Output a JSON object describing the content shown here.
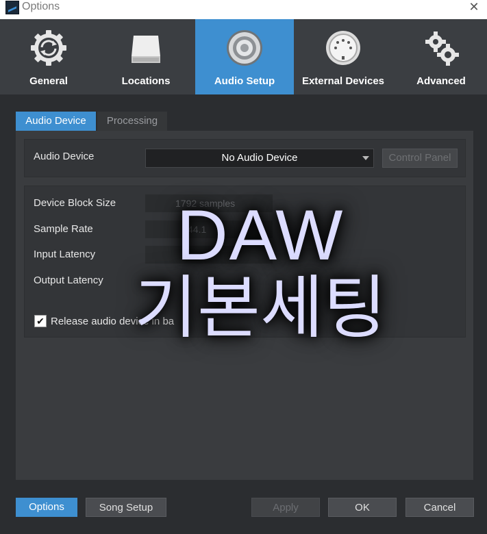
{
  "window": {
    "title": "Options",
    "close_glyph": "✕"
  },
  "main_tabs": [
    {
      "label": "General",
      "icon": "sync-gear-icon"
    },
    {
      "label": "Locations",
      "icon": "drive-icon"
    },
    {
      "label": "Audio Setup",
      "icon": "speaker-icon",
      "active": true
    },
    {
      "label": "External Devices",
      "icon": "midi-port-icon"
    },
    {
      "label": "Advanced",
      "icon": "gears-icon"
    }
  ],
  "sub_tabs": {
    "audio_device": "Audio Device",
    "processing": "Processing"
  },
  "audio_device_section": {
    "label": "Audio Device",
    "selected_device": "No Audio Device",
    "control_panel": "Control Panel"
  },
  "settings": {
    "block_size_label": "Device Block Size",
    "block_size_value": "1792 samples",
    "sample_rate_label": "Sample Rate",
    "sample_rate_value": "44.1",
    "input_latency_label": "Input Latency",
    "output_latency_label": "Output Latency",
    "release_label": "Release audio device in ba",
    "release_checked": true
  },
  "watermark": {
    "line1": "DAW",
    "line2": "기본세팅"
  },
  "footer": {
    "options": "Options",
    "song_setup": "Song Setup",
    "apply": "Apply",
    "ok": "OK",
    "cancel": "Cancel"
  },
  "colors": {
    "accent": "#3e8fd0",
    "background": "#2b2d30",
    "tabbar": "#3b3e42"
  }
}
